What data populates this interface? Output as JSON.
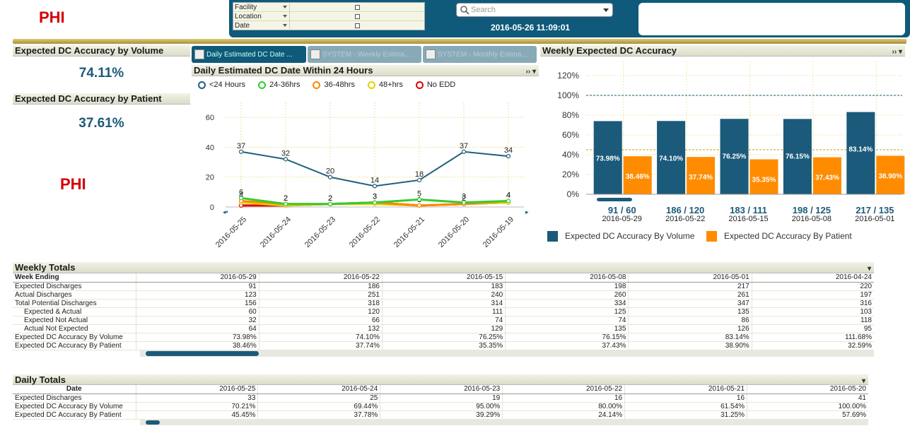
{
  "phi_text": "PHI",
  "filters": [
    {
      "label": "Facility"
    },
    {
      "label": "Location"
    },
    {
      "label": "Date"
    }
  ],
  "search": {
    "placeholder": "Search"
  },
  "datetime": "2016-05-26 11:09:01",
  "kpis": {
    "volume_title": "Expected DC Accuracy by Volume",
    "volume_value": "74.11%",
    "patient_title": "Expected DC Accuracy by Patient",
    "patient_value": "37.61%"
  },
  "tabs": [
    {
      "label": "Daily Estimated DC Date ..."
    },
    {
      "label": "SYSTEM - Weekly Estima..."
    },
    {
      "label": "SYSTEM - Monthly Estima..."
    }
  ],
  "line_chart_title": "Daily Estimated DC Date Within 24 Hours",
  "bar_chart_title": "Weekly Expected DC Accuracy",
  "chart_data": [
    {
      "type": "line",
      "x": [
        "2016-05-25",
        "2016-05-24",
        "2016-05-23",
        "2016-05-22",
        "2016-05-21",
        "2016-05-20",
        "2016-05-19"
      ],
      "ylim": [
        0,
        70
      ],
      "yticks": [
        0,
        20,
        40,
        60
      ],
      "series": [
        {
          "name": "<24 Hours",
          "color": "#1f5f80",
          "values": [
            37,
            32,
            20,
            14,
            18,
            37,
            34
          ]
        },
        {
          "name": "24-36hrs",
          "color": "#33cc33",
          "values": [
            6,
            2,
            2,
            3,
            5,
            3,
            4
          ]
        },
        {
          "name": "36-48hrs",
          "color": "#ff8800",
          "values": [
            4,
            2,
            2,
            3,
            1,
            2,
            4
          ]
        },
        {
          "name": "48+hrs",
          "color": "#e6d200",
          "values": [
            3,
            1,
            2,
            2,
            1,
            2,
            3
          ]
        },
        {
          "name": "No EDD",
          "color": "#e00000",
          "values": [
            1,
            1,
            2,
            3,
            1,
            2,
            3
          ]
        }
      ],
      "grid": true,
      "legend": "top"
    },
    {
      "type": "bar",
      "categories": [
        "2016-05-29",
        "2016-05-22",
        "2016-05-15",
        "2016-05-08",
        "2016-05-01"
      ],
      "category_top_labels": [
        "91 / 60",
        "186 / 120",
        "183 / 111",
        "198 / 125",
        "217 / 135"
      ],
      "ylim": [
        0,
        120
      ],
      "yticks": [
        "0%",
        "20%",
        "40%",
        "60%",
        "80%",
        "100%",
        "120%"
      ],
      "series": [
        {
          "name": "Expected DC Accuracy By Volume",
          "color": "#1b5a7a",
          "values": [
            73.98,
            74.1,
            76.25,
            76.15,
            83.14
          ],
          "labels": [
            "73.98%",
            "74.10%",
            "76.25%",
            "76.15%",
            "83.14%"
          ]
        },
        {
          "name": "Expected DC Accuracy By Patient",
          "color": "#ff8c00",
          "values": [
            38.46,
            37.74,
            35.35,
            37.43,
            38.9
          ],
          "labels": [
            "38.46%",
            "37.74%",
            "35.35%",
            "37.43%",
            "38.90%"
          ]
        }
      ],
      "reference_lines": [
        100,
        45
      ],
      "legend": "bottom"
    }
  ],
  "weekly": {
    "title": "Weekly Totals",
    "header_label": "Week Ending",
    "columns": [
      "2016-05-29",
      "2016-05-22",
      "2016-05-15",
      "2016-05-08",
      "2016-05-01",
      "2016-04-24"
    ],
    "rows": [
      {
        "label": "Expected Discharges",
        "indent": false,
        "values": [
          "91",
          "186",
          "183",
          "198",
          "217",
          "220"
        ]
      },
      {
        "label": "Actual Discharges",
        "indent": false,
        "values": [
          "123",
          "251",
          "240",
          "260",
          "261",
          "197"
        ]
      },
      {
        "label": "Total Potential Discharges",
        "indent": false,
        "values": [
          "156",
          "318",
          "314",
          "334",
          "347",
          "316"
        ]
      },
      {
        "label": "Expected & Actual",
        "indent": true,
        "values": [
          "60",
          "120",
          "111",
          "125",
          "135",
          "103"
        ]
      },
      {
        "label": "Expected Not Actual",
        "indent": true,
        "values": [
          "32",
          "66",
          "74",
          "74",
          "86",
          "118"
        ]
      },
      {
        "label": "Actual Not Expected",
        "indent": true,
        "values": [
          "64",
          "132",
          "129",
          "135",
          "126",
          "95"
        ]
      },
      {
        "label": "Expected DC Accuracy By Volume",
        "indent": false,
        "values": [
          "73.98%",
          "74.10%",
          "76.25%",
          "76.15%",
          "83.14%",
          "111.68%"
        ]
      },
      {
        "label": "Expected DC Accuracy By Patient",
        "indent": false,
        "values": [
          "38.46%",
          "37.74%",
          "35.35%",
          "37.43%",
          "38.90%",
          "32.59%"
        ]
      }
    ]
  },
  "daily": {
    "title": "Daily Totals",
    "header_label": "Date",
    "columns": [
      "2016-05-25",
      "2016-05-24",
      "2016-05-23",
      "2016-05-22",
      "2016-05-21",
      "2016-05-20"
    ],
    "rows": [
      {
        "label": "Expected Discharges",
        "values": [
          "33",
          "25",
          "19",
          "16",
          "16",
          "41"
        ]
      },
      {
        "label": "Expected DC Accuracy By Volume",
        "values": [
          "70.21%",
          "69.44%",
          "95.00%",
          "80.00%",
          "61.54%",
          "100.00%"
        ]
      },
      {
        "label": "Expected DC Accuracy By Patient",
        "values": [
          "45.45%",
          "37.78%",
          "39.29%",
          "24.14%",
          "31.25%",
          "57.69%"
        ]
      }
    ]
  },
  "icons": {
    "search": "search-icon",
    "minimize": "expand-icon",
    "menu": "dropdown-icon",
    "chart_tab": "line-chart-icon"
  }
}
